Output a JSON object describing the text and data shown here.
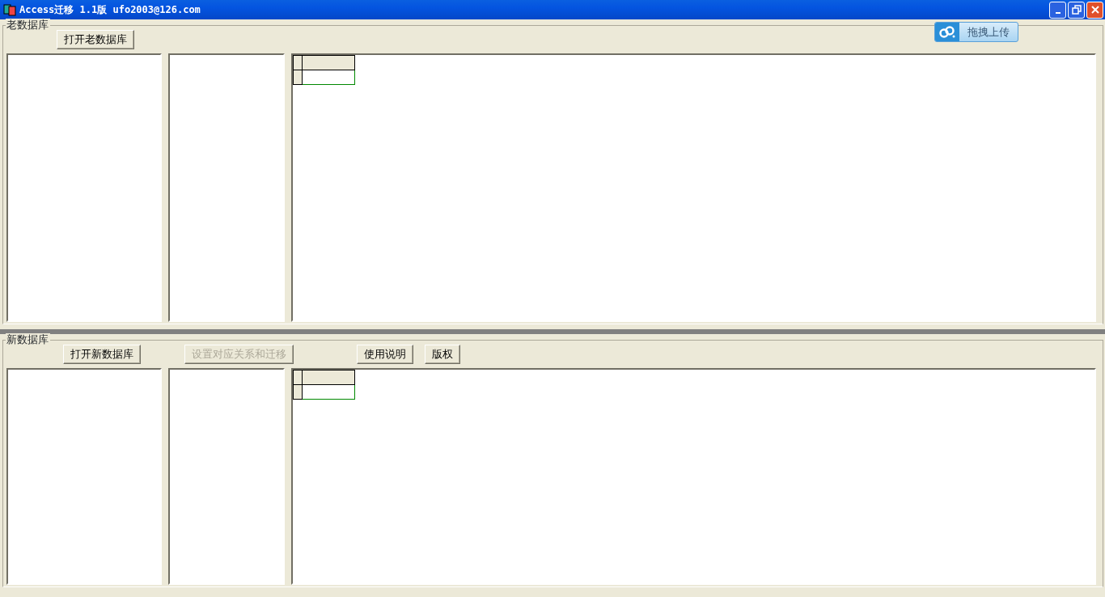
{
  "window": {
    "title": "Access迁移 1.1版 ufo2003@126.com"
  },
  "upload_button": {
    "label": "拖拽上传"
  },
  "sections": [
    {
      "title": "老数据库",
      "buttons": [
        {
          "label": "打开老数据库",
          "disabled": false
        }
      ]
    },
    {
      "title": "新数据库",
      "buttons": [
        {
          "label": "打开新数据库",
          "disabled": false
        },
        {
          "label": "设置对应关系和迁移",
          "disabled": true
        },
        {
          "label": "使用说明",
          "disabled": false
        },
        {
          "label": "版权",
          "disabled": false
        }
      ]
    }
  ]
}
